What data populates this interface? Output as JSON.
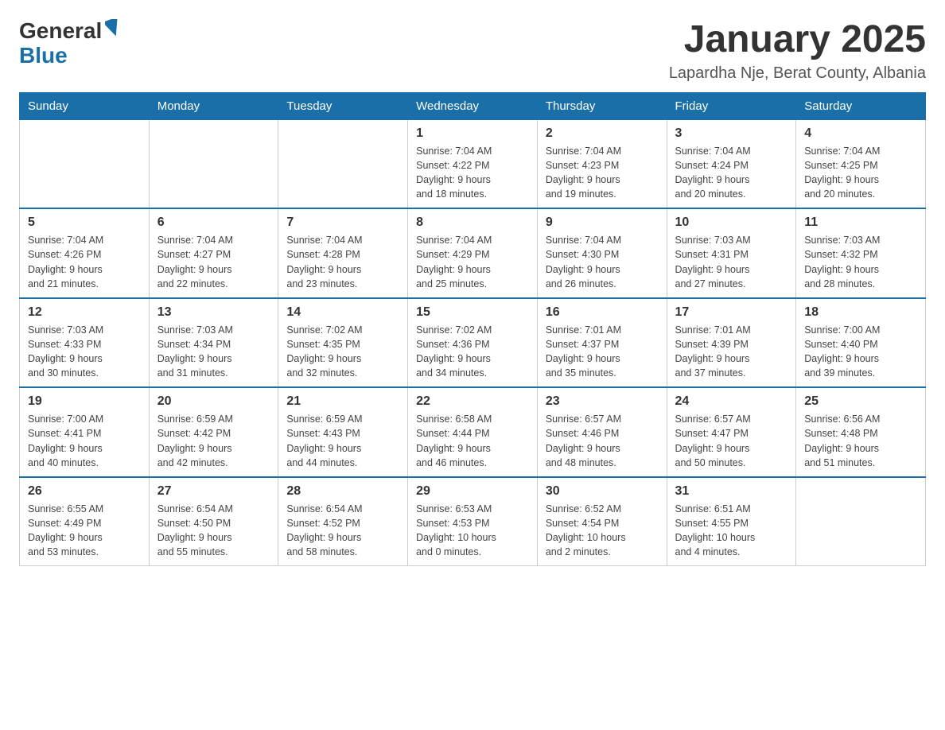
{
  "header": {
    "logo_general": "General",
    "logo_blue": "Blue",
    "month_title": "January 2025",
    "subtitle": "Lapardha Nje, Berat County, Albania"
  },
  "days_of_week": [
    "Sunday",
    "Monday",
    "Tuesday",
    "Wednesday",
    "Thursday",
    "Friday",
    "Saturday"
  ],
  "weeks": [
    [
      null,
      null,
      null,
      {
        "num": "1",
        "info": "Sunrise: 7:04 AM\nSunset: 4:22 PM\nDaylight: 9 hours\nand 18 minutes."
      },
      {
        "num": "2",
        "info": "Sunrise: 7:04 AM\nSunset: 4:23 PM\nDaylight: 9 hours\nand 19 minutes."
      },
      {
        "num": "3",
        "info": "Sunrise: 7:04 AM\nSunset: 4:24 PM\nDaylight: 9 hours\nand 20 minutes."
      },
      {
        "num": "4",
        "info": "Sunrise: 7:04 AM\nSunset: 4:25 PM\nDaylight: 9 hours\nand 20 minutes."
      }
    ],
    [
      {
        "num": "5",
        "info": "Sunrise: 7:04 AM\nSunset: 4:26 PM\nDaylight: 9 hours\nand 21 minutes."
      },
      {
        "num": "6",
        "info": "Sunrise: 7:04 AM\nSunset: 4:27 PM\nDaylight: 9 hours\nand 22 minutes."
      },
      {
        "num": "7",
        "info": "Sunrise: 7:04 AM\nSunset: 4:28 PM\nDaylight: 9 hours\nand 23 minutes."
      },
      {
        "num": "8",
        "info": "Sunrise: 7:04 AM\nSunset: 4:29 PM\nDaylight: 9 hours\nand 25 minutes."
      },
      {
        "num": "9",
        "info": "Sunrise: 7:04 AM\nSunset: 4:30 PM\nDaylight: 9 hours\nand 26 minutes."
      },
      {
        "num": "10",
        "info": "Sunrise: 7:03 AM\nSunset: 4:31 PM\nDaylight: 9 hours\nand 27 minutes."
      },
      {
        "num": "11",
        "info": "Sunrise: 7:03 AM\nSunset: 4:32 PM\nDaylight: 9 hours\nand 28 minutes."
      }
    ],
    [
      {
        "num": "12",
        "info": "Sunrise: 7:03 AM\nSunset: 4:33 PM\nDaylight: 9 hours\nand 30 minutes."
      },
      {
        "num": "13",
        "info": "Sunrise: 7:03 AM\nSunset: 4:34 PM\nDaylight: 9 hours\nand 31 minutes."
      },
      {
        "num": "14",
        "info": "Sunrise: 7:02 AM\nSunset: 4:35 PM\nDaylight: 9 hours\nand 32 minutes."
      },
      {
        "num": "15",
        "info": "Sunrise: 7:02 AM\nSunset: 4:36 PM\nDaylight: 9 hours\nand 34 minutes."
      },
      {
        "num": "16",
        "info": "Sunrise: 7:01 AM\nSunset: 4:37 PM\nDaylight: 9 hours\nand 35 minutes."
      },
      {
        "num": "17",
        "info": "Sunrise: 7:01 AM\nSunset: 4:39 PM\nDaylight: 9 hours\nand 37 minutes."
      },
      {
        "num": "18",
        "info": "Sunrise: 7:00 AM\nSunset: 4:40 PM\nDaylight: 9 hours\nand 39 minutes."
      }
    ],
    [
      {
        "num": "19",
        "info": "Sunrise: 7:00 AM\nSunset: 4:41 PM\nDaylight: 9 hours\nand 40 minutes."
      },
      {
        "num": "20",
        "info": "Sunrise: 6:59 AM\nSunset: 4:42 PM\nDaylight: 9 hours\nand 42 minutes."
      },
      {
        "num": "21",
        "info": "Sunrise: 6:59 AM\nSunset: 4:43 PM\nDaylight: 9 hours\nand 44 minutes."
      },
      {
        "num": "22",
        "info": "Sunrise: 6:58 AM\nSunset: 4:44 PM\nDaylight: 9 hours\nand 46 minutes."
      },
      {
        "num": "23",
        "info": "Sunrise: 6:57 AM\nSunset: 4:46 PM\nDaylight: 9 hours\nand 48 minutes."
      },
      {
        "num": "24",
        "info": "Sunrise: 6:57 AM\nSunset: 4:47 PM\nDaylight: 9 hours\nand 50 minutes."
      },
      {
        "num": "25",
        "info": "Sunrise: 6:56 AM\nSunset: 4:48 PM\nDaylight: 9 hours\nand 51 minutes."
      }
    ],
    [
      {
        "num": "26",
        "info": "Sunrise: 6:55 AM\nSunset: 4:49 PM\nDaylight: 9 hours\nand 53 minutes."
      },
      {
        "num": "27",
        "info": "Sunrise: 6:54 AM\nSunset: 4:50 PM\nDaylight: 9 hours\nand 55 minutes."
      },
      {
        "num": "28",
        "info": "Sunrise: 6:54 AM\nSunset: 4:52 PM\nDaylight: 9 hours\nand 58 minutes."
      },
      {
        "num": "29",
        "info": "Sunrise: 6:53 AM\nSunset: 4:53 PM\nDaylight: 10 hours\nand 0 minutes."
      },
      {
        "num": "30",
        "info": "Sunrise: 6:52 AM\nSunset: 4:54 PM\nDaylight: 10 hours\nand 2 minutes."
      },
      {
        "num": "31",
        "info": "Sunrise: 6:51 AM\nSunset: 4:55 PM\nDaylight: 10 hours\nand 4 minutes."
      },
      null
    ]
  ]
}
